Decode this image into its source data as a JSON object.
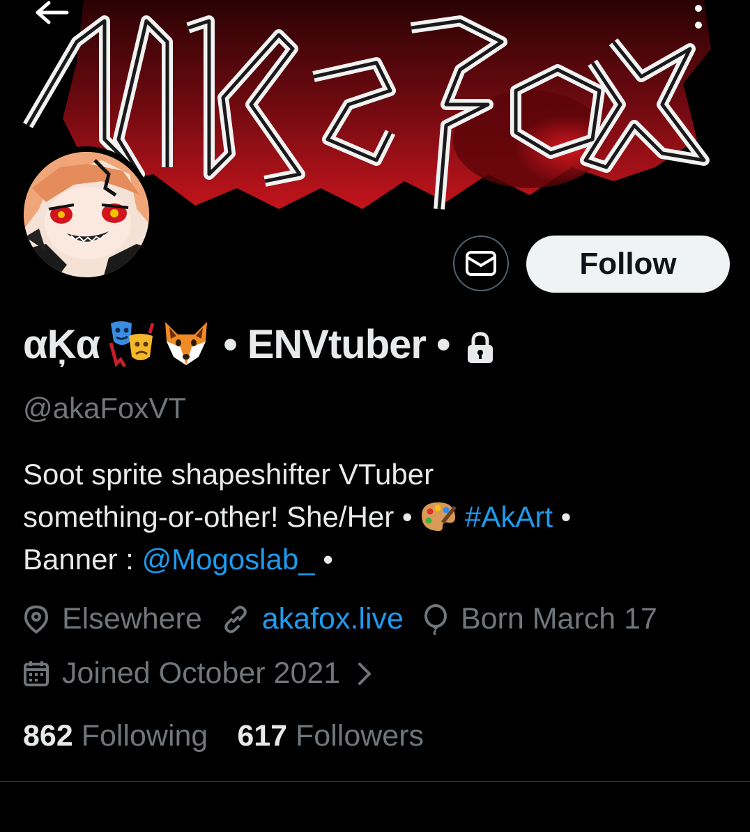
{
  "profile": {
    "name_part1": "αĶα",
    "name_part2": " • ENVtuber • ",
    "name_emojis": [
      "performing-arts-emoji",
      "fox-emoji"
    ],
    "protected": true,
    "handle": "@akaFoxVT",
    "bio": {
      "line1": "Soot sprite shapeshifter VTuber",
      "line2_text": "something-or-other! She/Her • ",
      "line2_hashtag": "#AkArt",
      "line2_tail": " •",
      "line3_text": "Banner : ",
      "line3_mention": "@Mogoslab_",
      "line3_tail": " •"
    },
    "location": "Elsewhere",
    "website": "akafox.live",
    "birthday": "Born March 17",
    "joined": "Joined October 2021",
    "following_count": "862",
    "following_label": " Following",
    "followers_count": "617",
    "followers_label": " Followers"
  },
  "actions": {
    "follow_label": "Follow",
    "message_icon": "mail-icon",
    "back_icon": "arrow-left-icon",
    "more_icon": "more-vertical-icon"
  },
  "banner": {
    "text": "AkaFox"
  },
  "colors": {
    "background": "#000000",
    "text_primary": "#e7e9ea",
    "text_secondary": "#71767b",
    "link": "#1d9bf0",
    "follow_bg": "#eff3f4",
    "banner_red": "#b3121a"
  }
}
